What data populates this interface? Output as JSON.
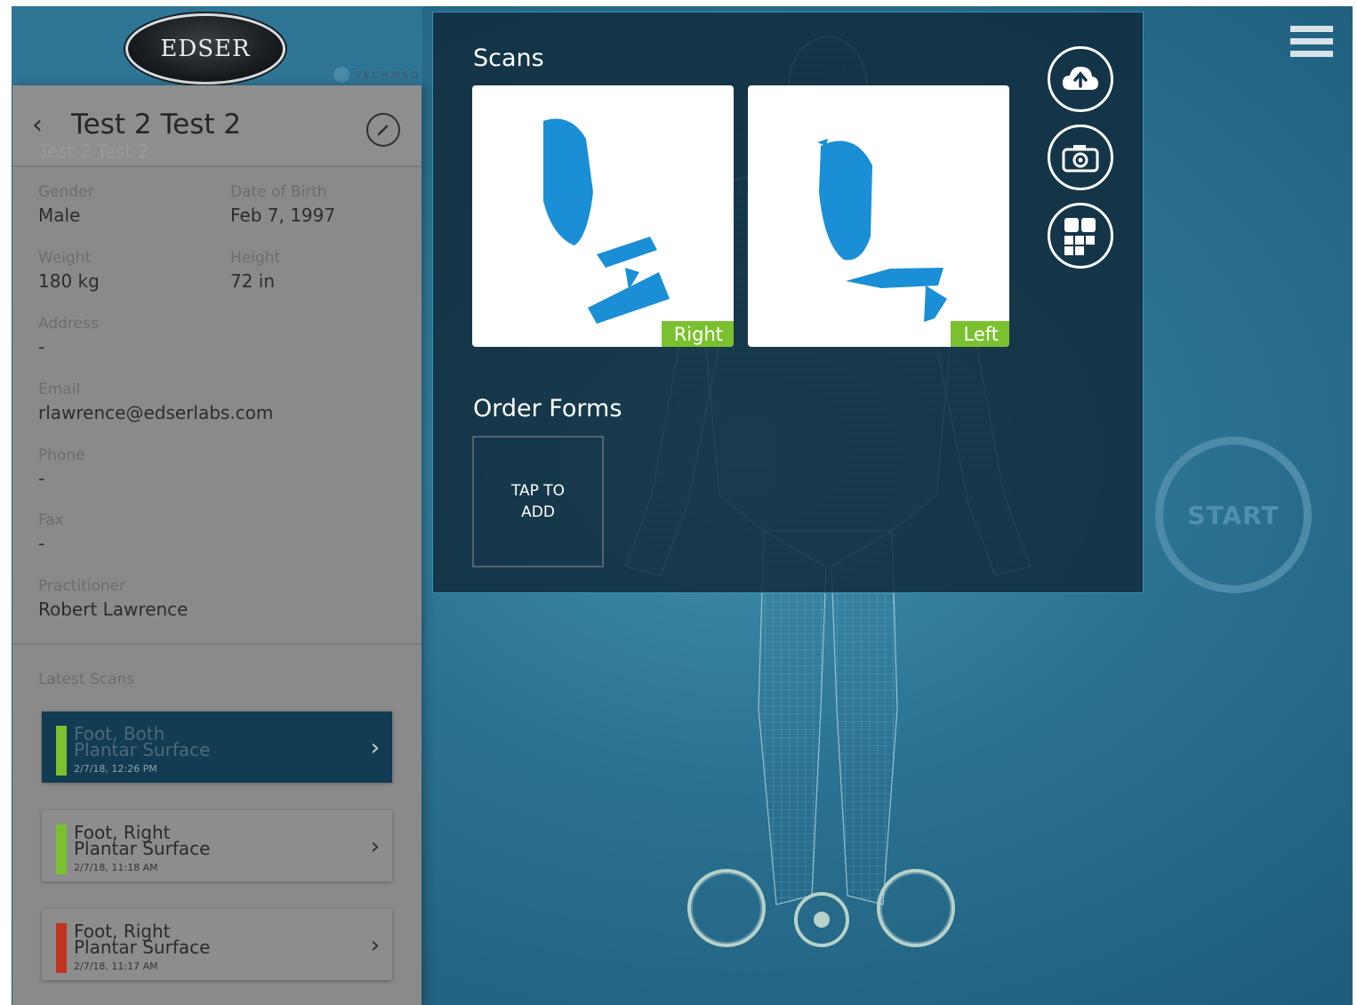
{
  "brand": {
    "logo_text": "EDSER",
    "partner_text": "TECHMED"
  },
  "patient": {
    "name": "Test 2 Test 2",
    "subtitle": "Test 2 Test 2",
    "fields": [
      {
        "label": "Gender",
        "value": "Male"
      },
      {
        "label": "Date of Birth",
        "value": "Feb 7, 1997"
      },
      {
        "label": "Weight",
        "value": "180 kg"
      },
      {
        "label": "Height",
        "value": "72 in"
      },
      {
        "label": "Address",
        "value": "-"
      },
      {
        "label": "Email",
        "value": "rlawrence@edserlabs.com"
      },
      {
        "label": "Phone",
        "value": "-"
      },
      {
        "label": "Fax",
        "value": "-"
      },
      {
        "label": "Practitioner",
        "value": "Robert Lawrence"
      }
    ]
  },
  "latest_scans": {
    "title": "Latest Scans",
    "items": [
      {
        "line1": "Foot, Both",
        "line2": "Plantar Surface",
        "timestamp": "2/7/18, 12:26 PM",
        "status_color": "#7bc12f",
        "active": true
      },
      {
        "line1": "Foot, Right",
        "line2": "Plantar Surface",
        "timestamp": "2/7/18, 11:18 AM",
        "status_color": "#7bc12f",
        "active": false
      },
      {
        "line1": "Foot, Right",
        "line2": "Plantar Surface",
        "timestamp": "2/7/18, 11:17 AM",
        "status_color": "#c0331e",
        "active": false
      }
    ]
  },
  "scans_panel": {
    "title": "Scans",
    "right_label": "Right",
    "left_label": "Left",
    "order_forms_title": "Order Forms",
    "tap_to_add_line1": "TAP TO",
    "tap_to_add_line2": "ADD"
  },
  "start_label": "START",
  "colors": {
    "accent_green": "#7bc12f",
    "accent_red": "#c0331e",
    "scan_blue": "#1a8fd6",
    "panel_dark": "#123c52"
  }
}
